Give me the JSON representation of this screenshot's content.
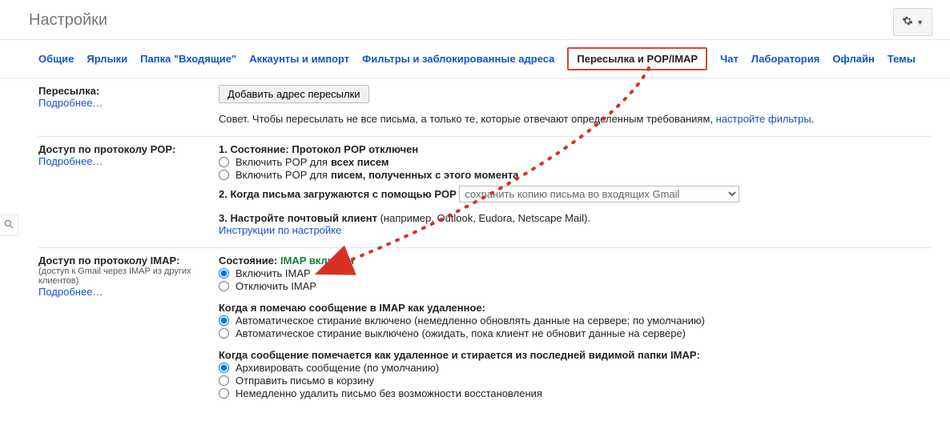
{
  "page_title": "Настройки",
  "tabs": {
    "general": "Общие",
    "labels": "Ярлыки",
    "inbox": "Папка \"Входящие\"",
    "accounts": "Аккаунты и импорт",
    "filters": "Фильтры и заблокированные адреса",
    "fwd_pop_imap": "Пересылка и POP/IMAP",
    "chat": "Чат",
    "labs": "Лаборатория",
    "offline": "Офлайн",
    "themes": "Темы"
  },
  "forwarding": {
    "title": "Пересылка:",
    "more": "Подробнее…",
    "add_btn": "Добавить адрес пересылки",
    "tip_pre": "Совет. Чтобы пересылать не все письма, а только те, которые отвечают определенным требованиям, ",
    "tip_link": "настройте фильтры",
    "tip_post": "."
  },
  "pop": {
    "title": "Доступ по протоколу POP:",
    "more": "Подробнее…",
    "status_label": "1. Состояние: ",
    "status_value": "Протокол POP отключен",
    "opt_all_pre": "Включить POP для ",
    "opt_all_bold": "всех писем",
    "opt_now_pre": "Включить POP для ",
    "opt_now_bold": "писем, полученных с этого момента",
    "step2": "2. Когда письма загружаются с помощью POP",
    "step2_select": "сохранить копию письма во входящих Gmail",
    "step3_pre": "3. Настройте почтовый клиент ",
    "step3_rest": "(например, Outlook, Eudora, Netscape Mail).",
    "step3_link": "Инструкции по настройке"
  },
  "imap": {
    "title": "Доступ по протоколу IMAP:",
    "sub": "(доступ к Gmail через IMAP из других клиентов)",
    "more": "Подробнее…",
    "status_label": "Состояние: ",
    "status_value": "IMAP включен",
    "enable": "Включить IMAP",
    "disable": "Отключить IMAP",
    "expunge_title": "Когда я помечаю сообщение в IMAP как удаленное:",
    "expunge_on": "Автоматическое стирание включено (немедленно обновлять данные на сервере; по умолчанию)",
    "expunge_off": "Автоматическое стирание выключено (ожидать, пока клиент не обновит данные на сервере)",
    "lastfolder_title": "Когда сообщение помечается как удаленное и стирается из последней видимой папки IMAP:",
    "lf_archive": "Архивировать сообщение (по умолчанию)",
    "lf_trash": "Отправить письмо в корзину",
    "lf_delete": "Немедленно удалить письмо без возможности восстановления"
  }
}
